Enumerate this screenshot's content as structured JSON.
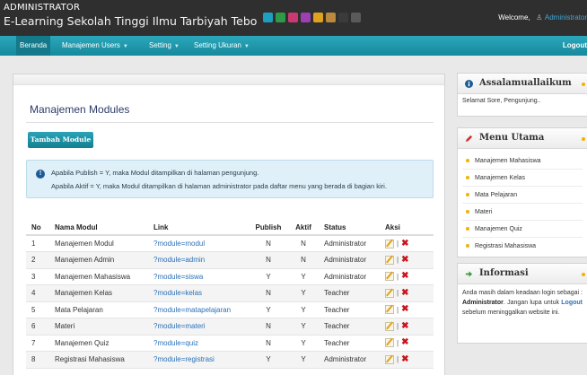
{
  "header": {
    "role": "ADMINISTRATOR",
    "site_title": "E-Learning Sekolah Tinggi Ilmu Tarbiyah Tebo",
    "theme_swatches": [
      "#1f9fbf",
      "#2e9a47",
      "#c93a73",
      "#9b3fb3",
      "#e0a21e",
      "#b98a3d",
      "#3b3b3b",
      "#5a5a5a"
    ],
    "welcome_label": "Welcome,",
    "user_name": "Administrator"
  },
  "nav": {
    "items": [
      {
        "label": "Beranda"
      },
      {
        "label": "Manajemen Users"
      },
      {
        "label": "Setting"
      },
      {
        "label": "Setting Ukuran"
      }
    ],
    "logout_label": "Logout"
  },
  "main": {
    "title": "Manajemen Modules",
    "add_button": "Tambah Module",
    "info_line1": "Apabila Publish = Y, maka Modul ditampilkan di halaman pengunjung.",
    "info_line2": "Apabila Aktif = Y, maka Modul ditampilkan di halaman administrator pada daftar menu yang berada di bagian kiri.",
    "table": {
      "headers": [
        "No",
        "Nama Modul",
        "Link",
        "Publish",
        "Aktif",
        "Status",
        "Aksi"
      ],
      "rows": [
        {
          "no": "1",
          "nama": "Manajemen Modul",
          "link": "?module=modul",
          "publish": "N",
          "aktif": "N",
          "status": "Administrator"
        },
        {
          "no": "2",
          "nama": "Manajemen Admin",
          "link": "?module=admin",
          "publish": "N",
          "aktif": "N",
          "status": "Administrator"
        },
        {
          "no": "3",
          "nama": "Manajemen Mahasiswa",
          "link": "?module=siswa",
          "publish": "Y",
          "aktif": "Y",
          "status": "Administrator"
        },
        {
          "no": "4",
          "nama": "Manajemen Kelas",
          "link": "?module=kelas",
          "publish": "N",
          "aktif": "Y",
          "status": "Teacher"
        },
        {
          "no": "5",
          "nama": "Mata Pelajaran",
          "link": "?module=matapelajaran",
          "publish": "Y",
          "aktif": "Y",
          "status": "Teacher"
        },
        {
          "no": "6",
          "nama": "Materi",
          "link": "?module=materi",
          "publish": "N",
          "aktif": "Y",
          "status": "Teacher"
        },
        {
          "no": "7",
          "nama": "Manajemen Quiz",
          "link": "?module=quiz",
          "publish": "N",
          "aktif": "Y",
          "status": "Teacher"
        },
        {
          "no": "8",
          "nama": "Registrasi Mahasiswa",
          "link": "?module=registrasi",
          "publish": "Y",
          "aktif": "Y",
          "status": "Administrator"
        }
      ],
      "action_separator": "|",
      "action_icons": [
        "edit-icon",
        "delete-icon"
      ]
    }
  },
  "sidebar": {
    "greeting": {
      "title": "Assalamuallaikum",
      "text": "Selamat Sore, Pengunjung.."
    },
    "menu": {
      "title": "Menu Utama",
      "items": [
        "Manajemen Mahasiswa",
        "Manajemen Kelas",
        "Mata Pelajaran",
        "Materi",
        "Manajemen Quiz",
        "Registrasi Mahasiswa"
      ]
    },
    "informasi": {
      "title": "Informasi",
      "text_a": "Anda masih dalam keadaan login sebagai :",
      "role": "Administrator",
      "text_b": "Jangan lupa untuk",
      "logout": "Logout",
      "text_c": "sebelum meninggalkan website ini."
    }
  }
}
